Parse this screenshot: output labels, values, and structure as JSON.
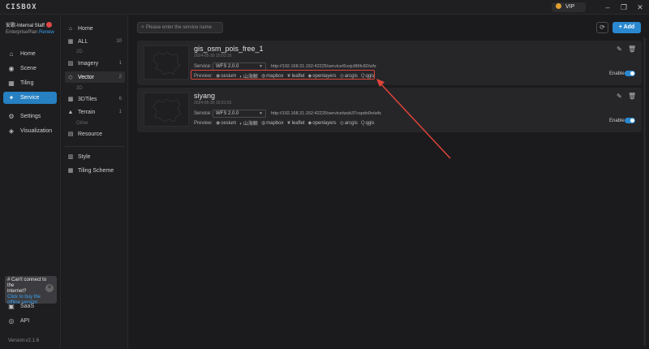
{
  "app": {
    "logo": "CISBOX",
    "vip": "VIP"
  },
  "window": {
    "minimize": "–",
    "restore": "❐",
    "close": "✕"
  },
  "user": {
    "name": "安歌-Internal Staff",
    "plan": "EnterprisePlan",
    "renew": "Renew"
  },
  "sidebar": {
    "items": [
      {
        "label": "Home",
        "icon": "home-icon"
      },
      {
        "label": "Scene",
        "icon": "globe-icon"
      },
      {
        "label": "Tiling",
        "icon": "tiling-icon"
      },
      {
        "label": "Service",
        "icon": "service-icon",
        "active": true
      },
      {
        "label": "Settings",
        "icon": "gear-icon"
      },
      {
        "label": "Visualization",
        "icon": "visualization-icon"
      }
    ],
    "bottom": [
      {
        "label": "SaaS",
        "icon": "saas-icon"
      },
      {
        "label": "API",
        "icon": "api-icon"
      }
    ],
    "offline_banner": {
      "line1": "# Can't connect to the",
      "line2": "internet?",
      "link": "Click to buy the offline version"
    },
    "version": "Version:v2.1.6"
  },
  "panel2": {
    "home": "Home",
    "all": {
      "label": "ALL",
      "count": "10"
    },
    "group_2d": "2D",
    "imagery": {
      "label": "Imagery",
      "count": "1"
    },
    "vector": {
      "label": "Vector",
      "count": "2"
    },
    "group_3d": "3D",
    "tiles3d": {
      "label": "3DTiles",
      "count": "6"
    },
    "terrain": {
      "label": "Terrain",
      "count": "1"
    },
    "group_other": "Other",
    "resource": "Resource",
    "style": "Style",
    "tiling_scheme": "Tiling Scheme"
  },
  "toolbar": {
    "search_placeholder": "Please enter the service name",
    "add_label": "+ Add"
  },
  "cards": [
    {
      "title": "gis_osm_pois_free_1",
      "date": "2024-05-30 15:01:16",
      "service_label": "Service:",
      "service_type": "WFS 2.0.0",
      "url": "http://192.168.31.152:42225/service/6vxjc8t9fc82/wfs",
      "preview_label": "Preview:",
      "previews": [
        "cesium",
        "山海鲸",
        "mapbox",
        "leaflet",
        "openlayers",
        "arcgis",
        "qgis"
      ],
      "enable_label": "Enable",
      "enabled": true
    },
    {
      "title": "siyang",
      "date": "2024-05-30 15:01:01",
      "service_label": "Service:",
      "service_type": "WFS 2.0.0",
      "url": "http://192.168.31.152:42225/service/wsb37cspdo0n/wfs",
      "preview_label": "Preview:",
      "previews": [
        "cesium",
        "山海鲸",
        "mapbox",
        "leaflet",
        "openlayers",
        "arcgis",
        "qgis"
      ],
      "enable_label": "Enable",
      "enabled": true
    }
  ],
  "colors": {
    "accent": "#2a88d0",
    "highlight": "#e0443a",
    "background": "#1b1b1d"
  }
}
